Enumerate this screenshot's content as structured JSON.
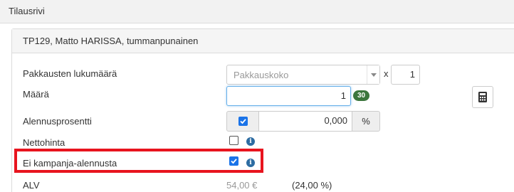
{
  "window": {
    "title": "Tilausrivi"
  },
  "panel": {
    "title": "TP129, Matto HARISSA, tummanpunainen"
  },
  "fields": {
    "package_count": {
      "label": "Pakkausten lukumäärä",
      "placeholder": "Pakkauskoko",
      "times": "x",
      "value": "1"
    },
    "quantity": {
      "label": "Määrä",
      "value": "1",
      "stock_badge": "30"
    },
    "discount": {
      "label": "Alennusprosentti",
      "enabled": true,
      "value": "0,000",
      "unit": "%"
    },
    "net_price": {
      "label": "Nettohinta",
      "checked": false
    },
    "no_campaign_discount": {
      "label": "Ei kampanja-alennusta",
      "checked": true
    },
    "vat": {
      "label": "ALV",
      "amount": "54,00 €",
      "rate": "(24,00 %)"
    }
  },
  "icons": {
    "calculator": "calculator-icon",
    "info": "info-icon",
    "dropdown": "chevron-down-icon"
  },
  "info_glyph": "i",
  "colors": {
    "highlight": "#e8141e",
    "badge": "#3c763d",
    "checkbox": "#1a73e8",
    "info": "#2d6ca2"
  }
}
